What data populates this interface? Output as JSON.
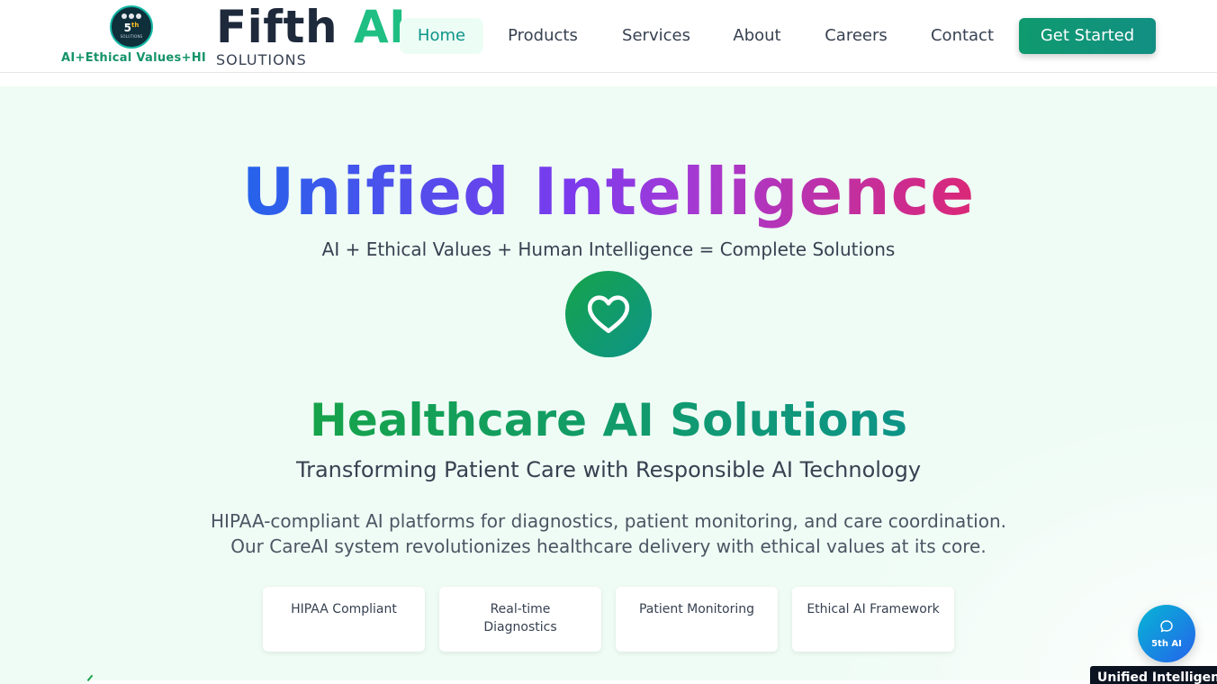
{
  "header": {
    "logo": {
      "mark": "5",
      "mark_sup": "th",
      "badge_small_text": "SOLUTIONS",
      "tagline": "AI+Ethical Values+HI",
      "icon": "group-people-icon"
    },
    "brand": {
      "name_part1": "Fifth",
      "name_part2": "AI",
      "subtitle": "SOLUTIONS"
    },
    "nav": [
      {
        "label": "Home",
        "active": true
      },
      {
        "label": "Products",
        "active": false
      },
      {
        "label": "Services",
        "active": false
      },
      {
        "label": "About",
        "active": false
      },
      {
        "label": "Careers",
        "active": false
      },
      {
        "label": "Contact",
        "active": false
      }
    ],
    "cta_label": "Get Started"
  },
  "hero": {
    "title": "Unified Intelligence",
    "tagline": "AI + Ethical Values + Human Intelligence = Complete Solutions",
    "icon": "heart-icon"
  },
  "section": {
    "title": "Healthcare AI Solutions",
    "subtitle": "Transforming Patient Care with Responsible AI Technology",
    "description": [
      "HIPAA-compliant AI platforms for diagnostics, patient monitoring, and care coordination.",
      "Our CareAI system revolutionizes healthcare delivery with ethical values at its core."
    ],
    "features": [
      {
        "label": "HIPAA Compliant"
      },
      {
        "label": "Real-time Diagnostics"
      },
      {
        "label": "Patient Monitoring"
      },
      {
        "label": "Ethical AI Framework"
      }
    ]
  },
  "chat": {
    "label": "5th AI",
    "icon": "chat-bubble-icon",
    "tooltip": "Unified Intelligence"
  },
  "colors": {
    "accent_green": "#16a34a",
    "accent_teal": "#0d9488",
    "hero_bg": "#effcf5",
    "title_gradient_start": "#2563eb",
    "title_gradient_end": "#db2777"
  }
}
